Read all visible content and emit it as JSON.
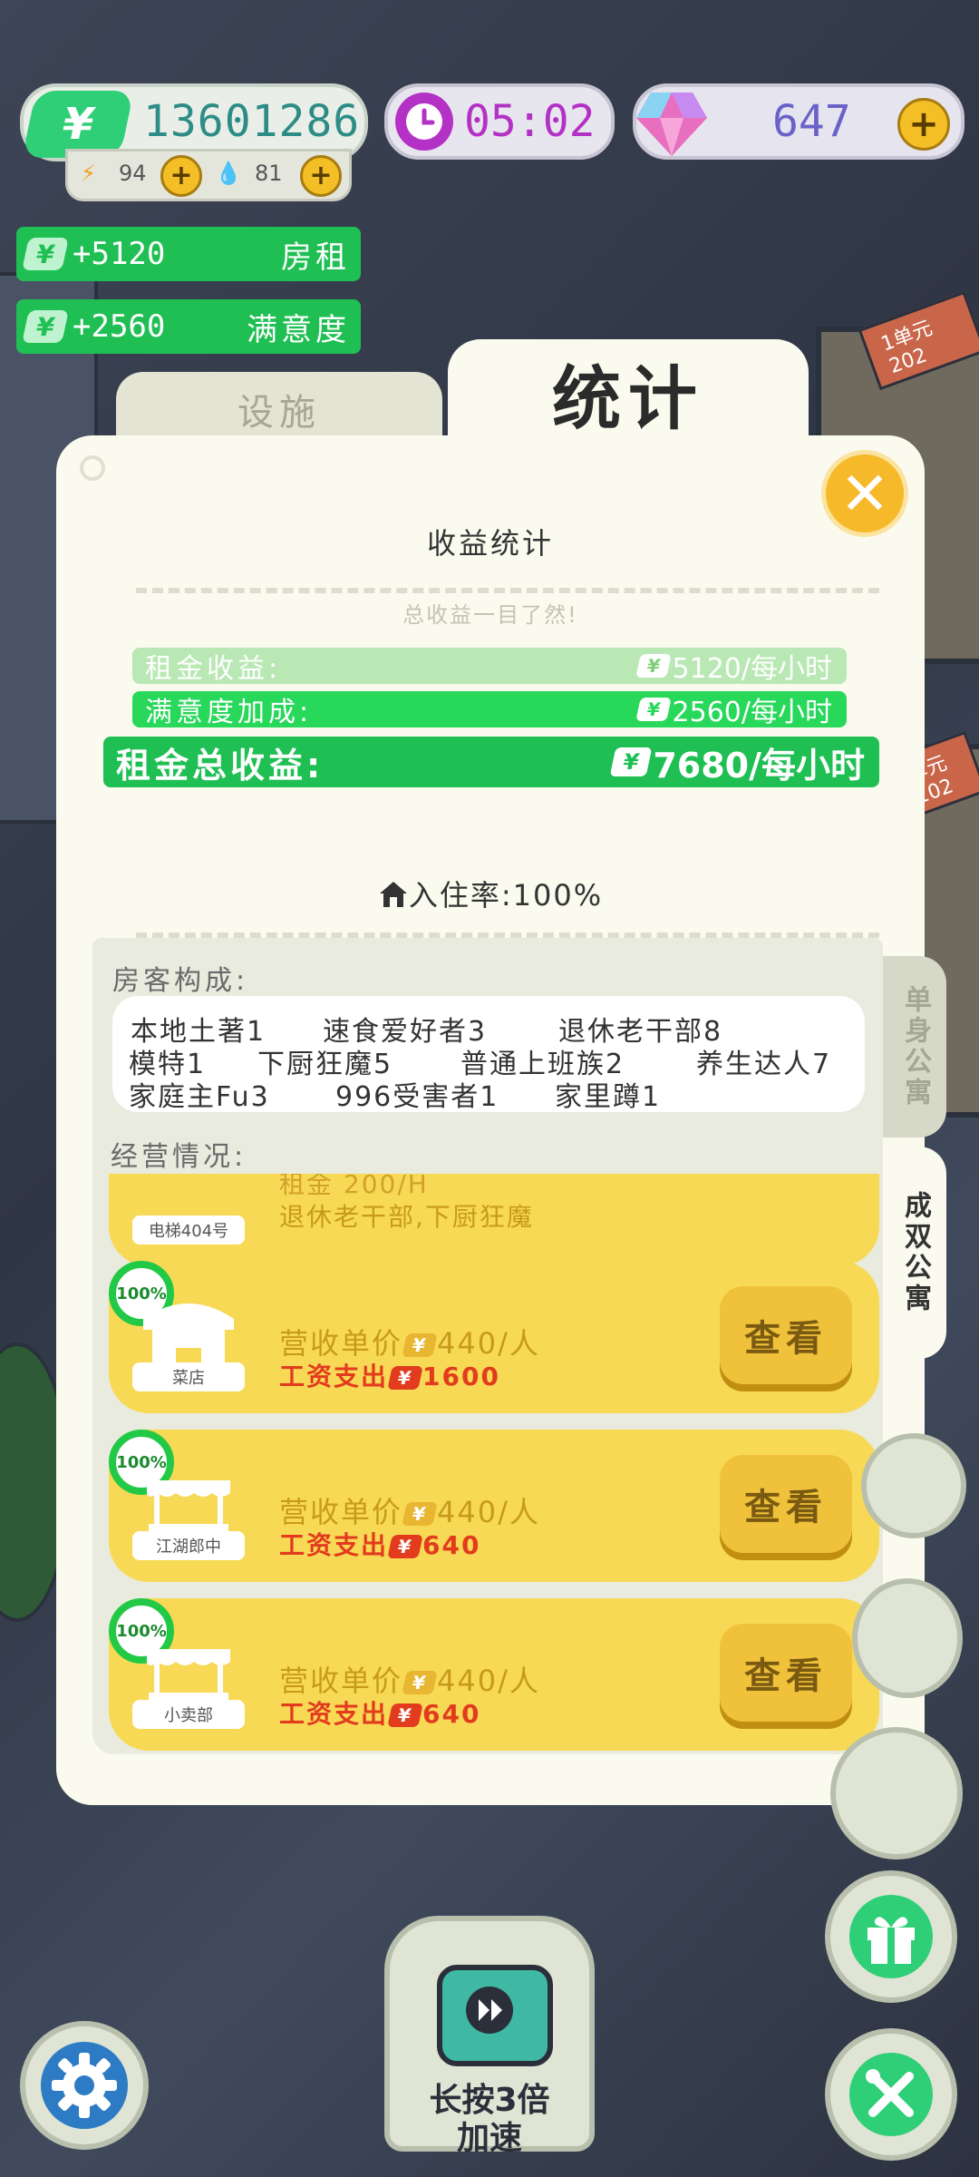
{
  "hud": {
    "money": "13601286",
    "energy": "94",
    "water": "81",
    "timer": "05:02",
    "gems": "647"
  },
  "income_badges": [
    {
      "amount": "+5120",
      "label": "房租"
    },
    {
      "amount": "+2560",
      "label": "满意度"
    }
  ],
  "background_labels": [
    "1单元202",
    "单元102"
  ],
  "tabs": {
    "facilities": "设施",
    "statistics": "统计"
  },
  "panel": {
    "title": "收益统计",
    "subtitle": "总收益一目了然!",
    "rows": [
      {
        "label": "租金收益:",
        "value": "5120/每小时"
      },
      {
        "label": "满意度加成:",
        "value": "2560/每小时"
      },
      {
        "label": "租金总收益:",
        "value": "7680/每小时"
      }
    ],
    "occupancy": "入住率:100%",
    "composition_title": "房客构成:",
    "composition": [
      [
        "本地土著1",
        "速食爱好者3",
        "退休老干部8"
      ],
      [
        "模特1",
        "下厨狂魔5",
        "普通上班族2",
        "养生达人7"
      ],
      [
        "家庭主Fu3",
        "996受害者1",
        "家里蹲1"
      ]
    ],
    "business_title": "经营情况:",
    "partial_card": {
      "name": "电梯404号",
      "line1": "租金  200/H",
      "line2": "退休老干部,下厨狂魔"
    },
    "cards": [
      {
        "pct": "100%",
        "name": "菜店",
        "price_label": "营收单价",
        "price": "440/人",
        "wage_label": "工资支出",
        "wage": "1600",
        "button": "查看"
      },
      {
        "pct": "100%",
        "name": "江湖郎中",
        "price_label": "营收单价",
        "price": "440/人",
        "wage_label": "工资支出",
        "wage": "640",
        "button": "查看"
      },
      {
        "pct": "100%",
        "name": "小卖部",
        "price_label": "营收单价",
        "price": "440/人",
        "wage_label": "工资支出",
        "wage": "640",
        "button": "查看"
      }
    ],
    "side_tabs": [
      "单身公寓",
      "成双公寓"
    ]
  },
  "speed_button": {
    "line1": "长按3倍",
    "line2": "加速"
  },
  "colors": {
    "green": "#1fbf54",
    "bright_green": "#27d85a",
    "yellow": "#f8d955",
    "red": "#e23b1e",
    "purple": "#b431c6"
  },
  "icons": [
    "settings-gear-icon",
    "gift-icon",
    "tools-icon",
    "close-icon",
    "house-icon",
    "clock-icon",
    "gem-icon"
  ]
}
